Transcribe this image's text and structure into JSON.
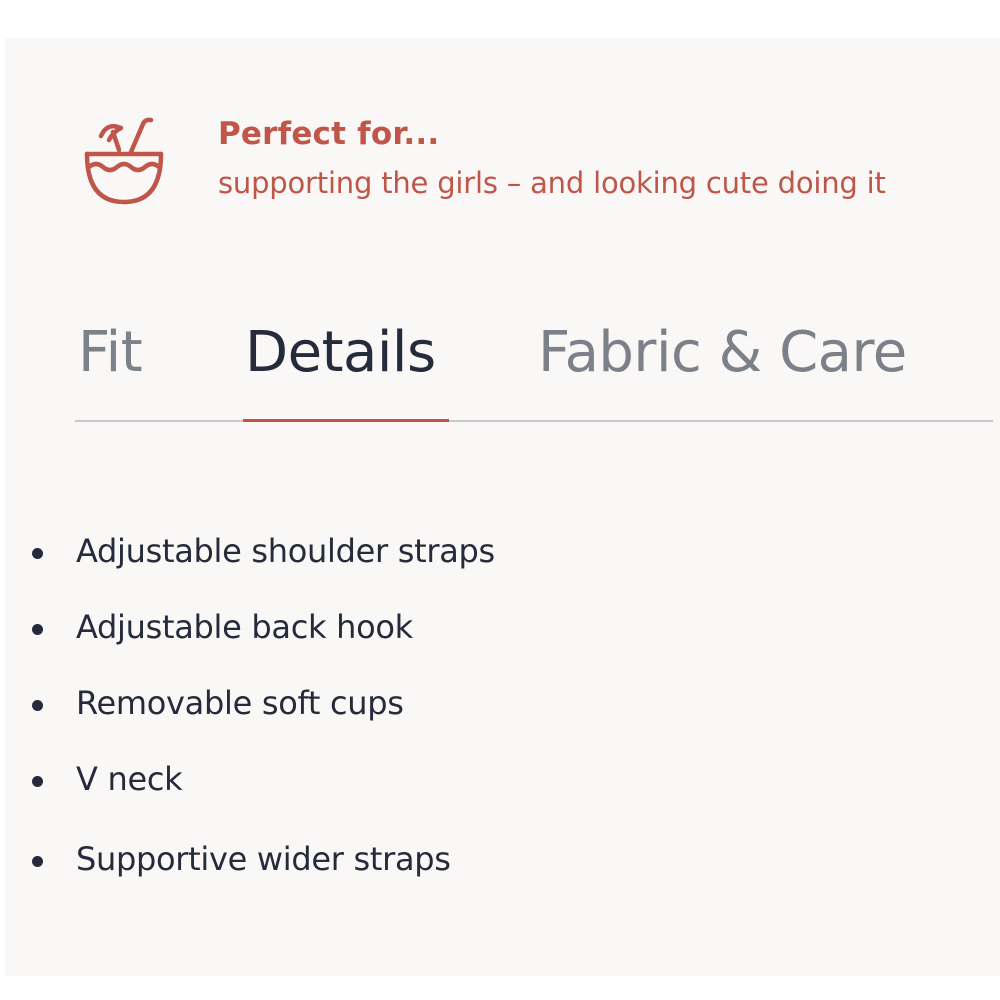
{
  "promo": {
    "icon": "coconut-drink-icon",
    "title": "Perfect for...",
    "subtitle": "supporting the girls – and looking cute doing it"
  },
  "tabs": [
    {
      "label": "Fit",
      "active": false
    },
    {
      "label": "Details",
      "active": true
    },
    {
      "label": "Fabric & Care",
      "active": false
    }
  ],
  "details": {
    "items": [
      "Adjustable shoulder straps",
      "Adjustable back hook",
      "Removable soft cups",
      "V neck",
      "Supportive wider straps"
    ]
  },
  "colors": {
    "accent": "#c0564a",
    "text": "#262b3c",
    "muted": "#7c8089",
    "background": "#f9f8f6"
  }
}
